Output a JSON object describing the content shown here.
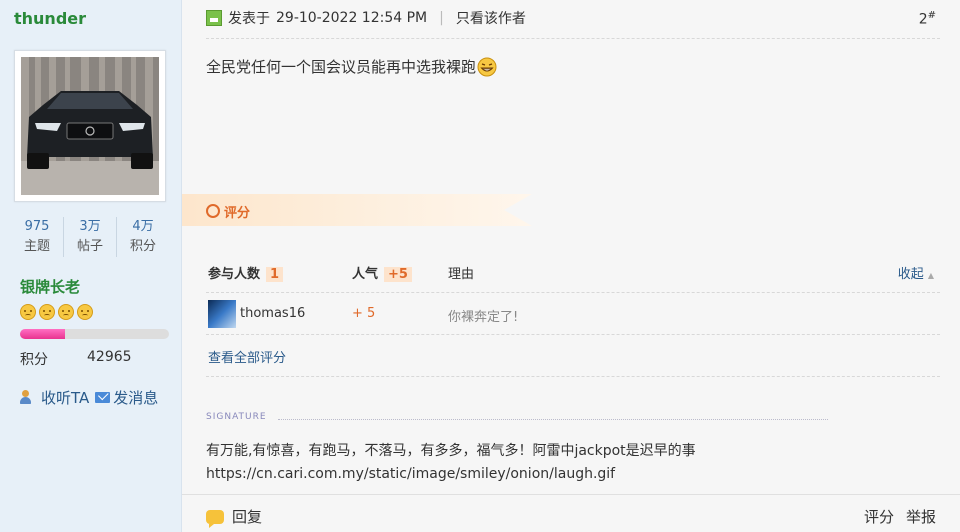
{
  "user": {
    "name": "thunder",
    "stats": [
      {
        "value": "975",
        "label": "主题"
      },
      {
        "value": "3万",
        "label": "帖子"
      },
      {
        "value": "4万",
        "label": "积分"
      }
    ],
    "rank": "银牌长老",
    "progress": 0.3,
    "points_label": "积分",
    "points_value": "42965",
    "follow_label": "收听TA",
    "message_label": "发消息"
  },
  "post": {
    "posted_label": "发表于",
    "datetime": "29-10-2022 12:54 PM",
    "separator": "|",
    "author_only": "只看该作者",
    "floor": "2",
    "floor_mark": "#",
    "content": "全民党任何一个国会议员能再中选我裸跑",
    "icon_colors": {
      "accent": "#e06a2a",
      "link": "#2a5a8a",
      "username": "#2a8a3a"
    }
  },
  "rating": {
    "tab_label": "评分",
    "col_participants": "参与人数",
    "participants_count": "1",
    "col_popularity": "人气",
    "popularity_total": "+5",
    "col_reason": "理由",
    "collapse": "收起",
    "rows": [
      {
        "user": "thomas16",
        "score": "+ 5",
        "reason": "你裸奔定了!"
      }
    ],
    "view_all": "查看全部评分"
  },
  "signature": {
    "label": "SIGNATURE",
    "line1": "有万能,有惊喜，有跑马，不落马，有多多，福气多！阿雷中jackpot是迟早的事",
    "line2": "https://cn.cari.com.my/static/image/smiley/onion/laugh.gif"
  },
  "footer": {
    "reply": "回复",
    "rate": "评分",
    "report": "举报"
  }
}
